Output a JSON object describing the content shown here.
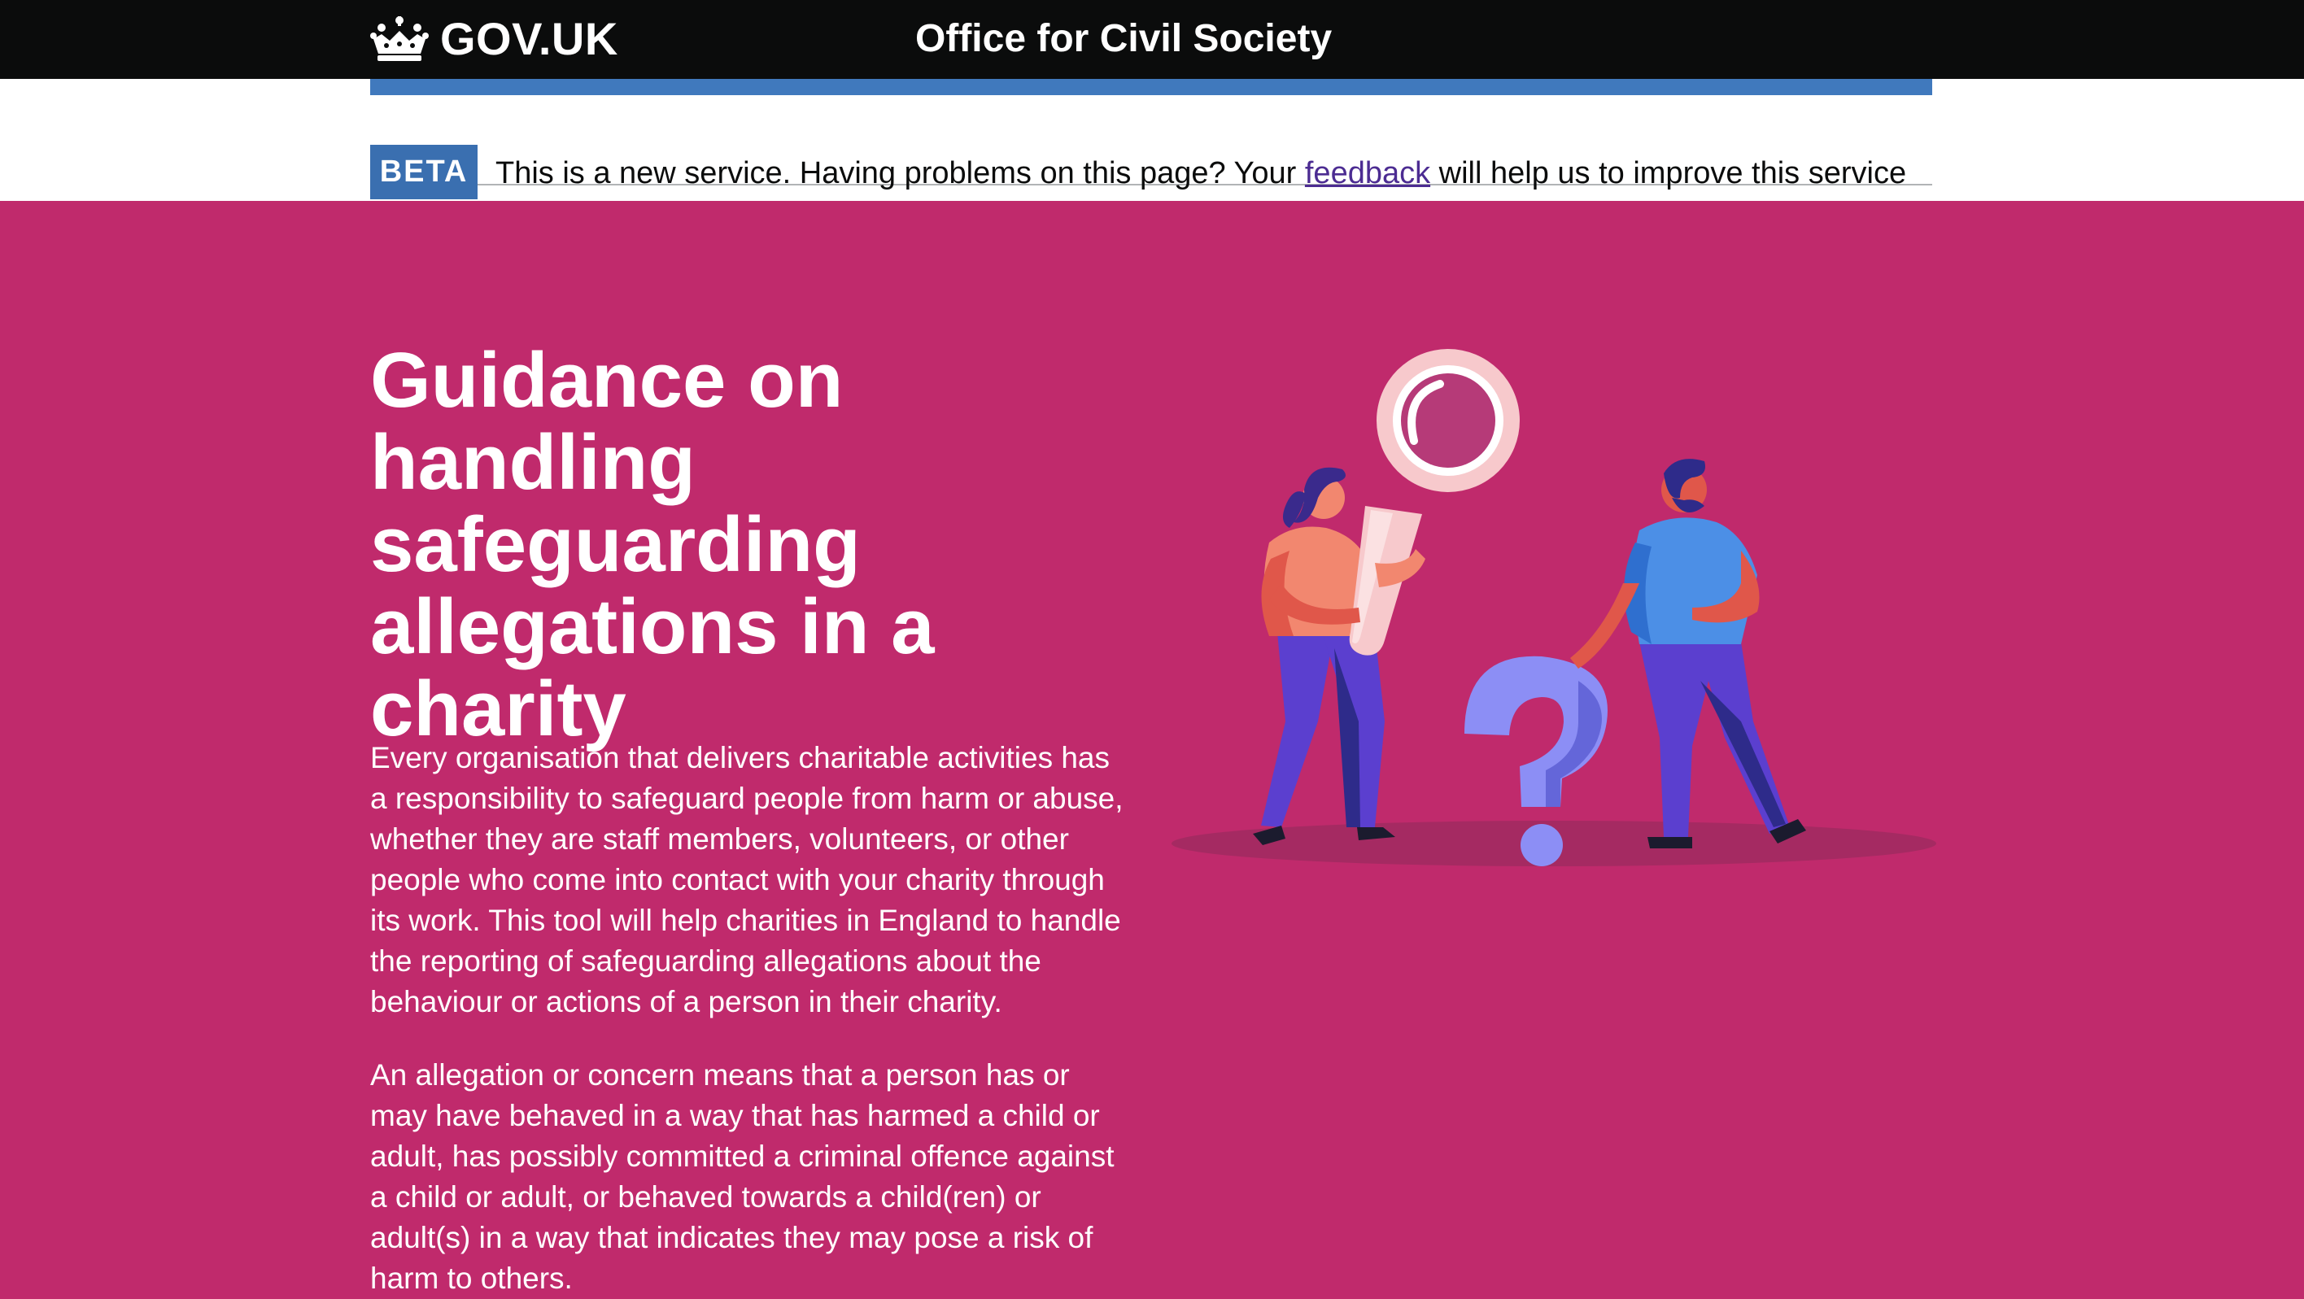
{
  "header": {
    "logo_text": "GOV.UK",
    "service_name": "Office for Civil Society"
  },
  "phase_banner": {
    "tag": "BETA",
    "text_before": "This is a new service. Having problems on this page? Your ",
    "link_text": "feedback",
    "text_after": " will help us to improve this service"
  },
  "hero": {
    "title": "Guidance on handling safeguarding allegations in a charity",
    "paragraphs": [
      "Every organisation that delivers charitable activities has a responsibility to safeguard people from harm or abuse, whether they are staff members, volunteers, or other people who come into contact with your charity through its work. This tool will help charities in England to handle the reporting of safeguarding allegations about the behaviour or actions of a person in their charity.",
      "An allegation or concern means that a person has or may have behaved in a way that has harmed a child or adult, has possibly committed a criminal offence against a child or adult, or behaved towards a child(ren) or adult(s) in a way that indicates they may pose a risk of harm to others."
    ],
    "illustration_icon": "magnifying-glass-question-people-illustration"
  },
  "colors": {
    "header_bg": "#0b0c0c",
    "hero_bg": "#c02a6c",
    "beta_tag": "#3a6fb0",
    "blue_bar": "#4079bd",
    "link": "#4c2c92"
  }
}
